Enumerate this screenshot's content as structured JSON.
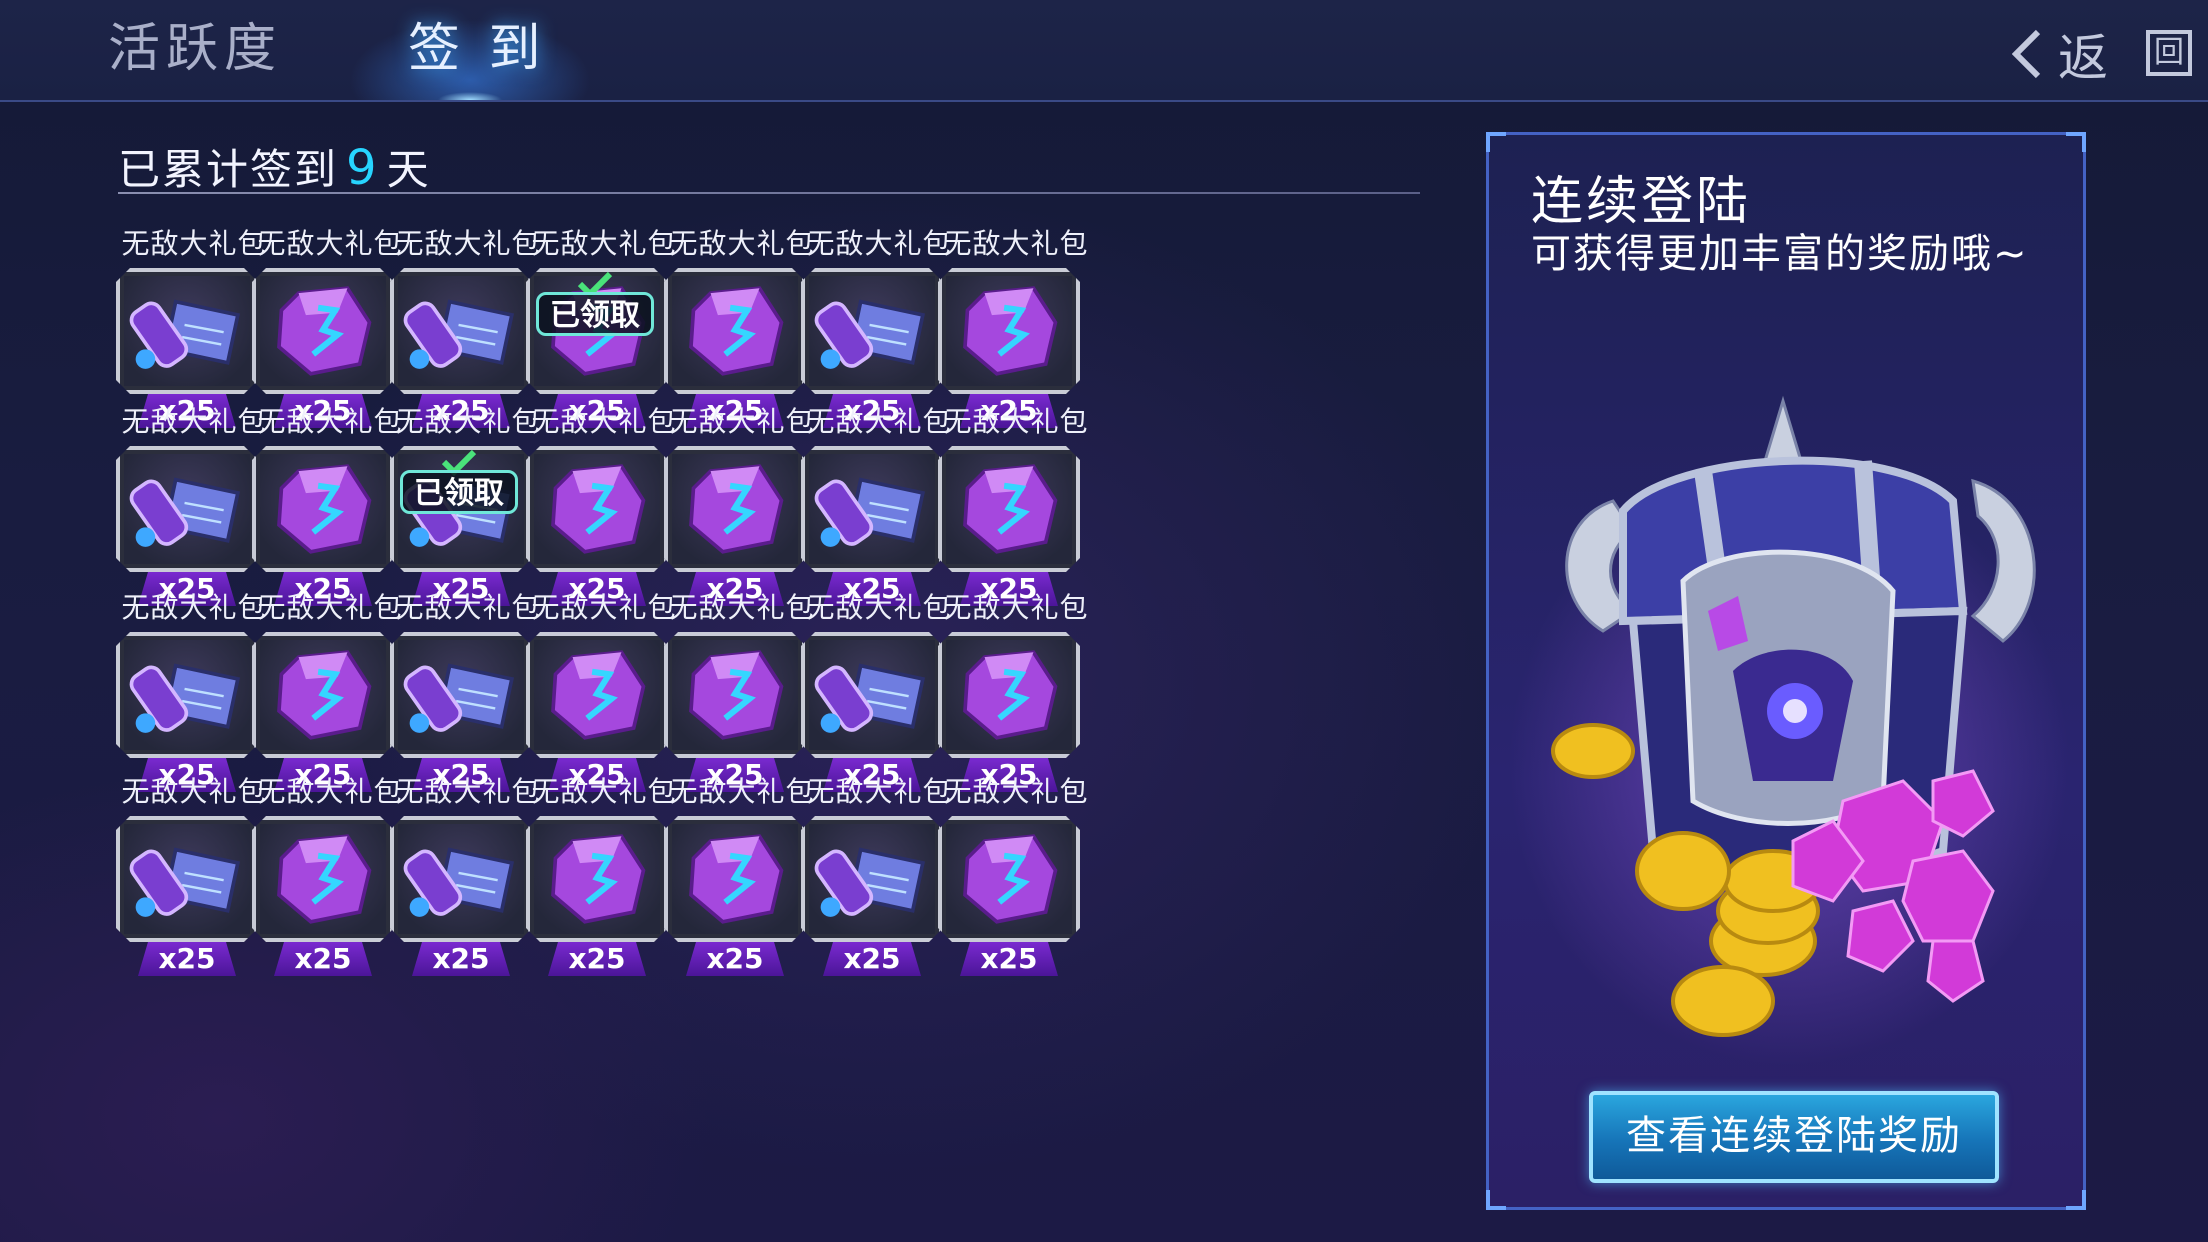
{
  "tabs": {
    "activity": "活跃度",
    "signin": "签 到"
  },
  "nav": {
    "back_label": "返",
    "exit_label": "回"
  },
  "counter": {
    "prefix": "已累计签到",
    "days": "9",
    "suffix": "天"
  },
  "rewards": {
    "item_name": "无敌大礼包",
    "claimed_label": "已领取",
    "items": [
      {
        "name": "无敌大礼包",
        "qty": "x25",
        "icon": "scroll-icon",
        "claimed": false
      },
      {
        "name": "无敌大礼包",
        "qty": "x25",
        "icon": "crystal-icon",
        "claimed": false
      },
      {
        "name": "无敌大礼包",
        "qty": "x25",
        "icon": "scroll-icon",
        "claimed": false
      },
      {
        "name": "无敌大礼包",
        "qty": "x25",
        "icon": "crystal-icon",
        "claimed": true
      },
      {
        "name": "无敌大礼包",
        "qty": "x25",
        "icon": "crystal-icon",
        "claimed": false
      },
      {
        "name": "无敌大礼包",
        "qty": "x25",
        "icon": "scroll-icon",
        "claimed": false
      },
      {
        "name": "无敌大礼包",
        "qty": "x25",
        "icon": "crystal-icon",
        "claimed": false
      },
      {
        "name": "无敌大礼包",
        "qty": "x25",
        "icon": "scroll-icon",
        "claimed": false
      },
      {
        "name": "无敌大礼包",
        "qty": "x25",
        "icon": "crystal-icon",
        "claimed": false
      },
      {
        "name": "无敌大礼包",
        "qty": "x25",
        "icon": "scroll-icon",
        "claimed": true
      },
      {
        "name": "无敌大礼包",
        "qty": "x25",
        "icon": "crystal-icon",
        "claimed": false
      },
      {
        "name": "无敌大礼包",
        "qty": "x25",
        "icon": "crystal-icon",
        "claimed": false
      },
      {
        "name": "无敌大礼包",
        "qty": "x25",
        "icon": "scroll-icon",
        "claimed": false
      },
      {
        "name": "无敌大礼包",
        "qty": "x25",
        "icon": "crystal-icon",
        "claimed": false
      },
      {
        "name": "无敌大礼包",
        "qty": "x25",
        "icon": "scroll-icon",
        "claimed": false
      },
      {
        "name": "无敌大礼包",
        "qty": "x25",
        "icon": "crystal-icon",
        "claimed": false
      },
      {
        "name": "无敌大礼包",
        "qty": "x25",
        "icon": "scroll-icon",
        "claimed": false
      },
      {
        "name": "无敌大礼包",
        "qty": "x25",
        "icon": "crystal-icon",
        "claimed": false
      },
      {
        "name": "无敌大礼包",
        "qty": "x25",
        "icon": "crystal-icon",
        "claimed": false
      },
      {
        "name": "无敌大礼包",
        "qty": "x25",
        "icon": "scroll-icon",
        "claimed": false
      },
      {
        "name": "无敌大礼包",
        "qty": "x25",
        "icon": "crystal-icon",
        "claimed": false
      },
      {
        "name": "无敌大礼包",
        "qty": "x25",
        "icon": "scroll-icon",
        "claimed": false
      },
      {
        "name": "无敌大礼包",
        "qty": "x25",
        "icon": "crystal-icon",
        "claimed": false
      },
      {
        "name": "无敌大礼包",
        "qty": "x25",
        "icon": "scroll-icon",
        "claimed": false
      },
      {
        "name": "无敌大礼包",
        "qty": "x25",
        "icon": "crystal-icon",
        "claimed": false
      },
      {
        "name": "无敌大礼包",
        "qty": "x25",
        "icon": "crystal-icon",
        "claimed": false
      },
      {
        "name": "无敌大礼包",
        "qty": "x25",
        "icon": "scroll-icon",
        "claimed": false
      },
      {
        "name": "无敌大礼包",
        "qty": "x25",
        "icon": "crystal-icon",
        "claimed": false
      }
    ]
  },
  "panel": {
    "title": "连续登陆",
    "subtitle": "可获得更加丰富的奖励哦~",
    "button_label": "查看连续登陆奖励",
    "art_icon": "treasure-chest-icon"
  },
  "colors": {
    "accent": "#27d4ff",
    "qty_badge": "#6a22c0",
    "button": "#1a86c8"
  }
}
